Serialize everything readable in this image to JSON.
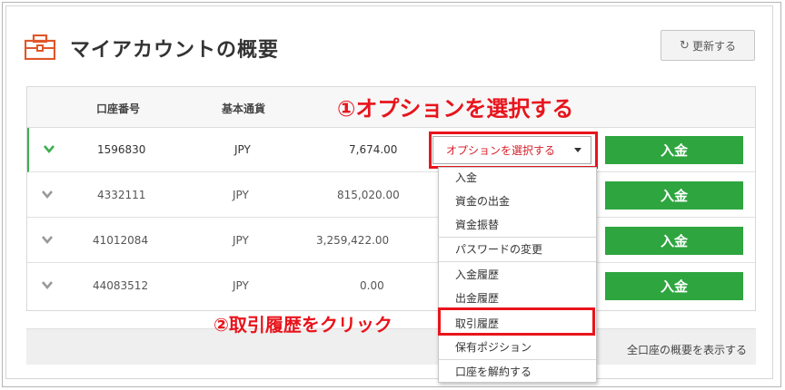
{
  "header": {
    "title": "マイアカウントの概要",
    "refresh_label": "更新する"
  },
  "table": {
    "columns": [
      "口座番号",
      "基本通貨"
    ],
    "rows": [
      {
        "account": "1596830",
        "currency": "JPY",
        "balance": "7,674.00",
        "deposit_label": "入金",
        "expanded": true
      },
      {
        "account": "4332111",
        "currency": "JPY",
        "balance": "815,020.00",
        "deposit_label": "入金",
        "expanded": false
      },
      {
        "account": "41012084",
        "currency": "JPY",
        "balance": "3,259,422.00",
        "deposit_label": "入金",
        "expanded": false
      },
      {
        "account": "44083512",
        "currency": "JPY",
        "balance": "0.00",
        "deposit_label": "入金",
        "expanded": false
      }
    ]
  },
  "select": {
    "label": "オプションを選択する"
  },
  "dropdown": {
    "items": [
      "入金",
      "資金の出金",
      "資金振替",
      "パスワードの変更",
      "入金履歴",
      "出金履歴",
      "取引履歴",
      "保有ポジション",
      "口座を解約する"
    ]
  },
  "footer": {
    "link_label": "全口座の概要を表示する"
  },
  "annotations": {
    "step1": "①オプションを選択する",
    "step2": "②取引履歴をクリック"
  },
  "colors": {
    "accent_red": "#e8141c",
    "green": "#2ea53f",
    "icon_orange": "#e0562a"
  }
}
